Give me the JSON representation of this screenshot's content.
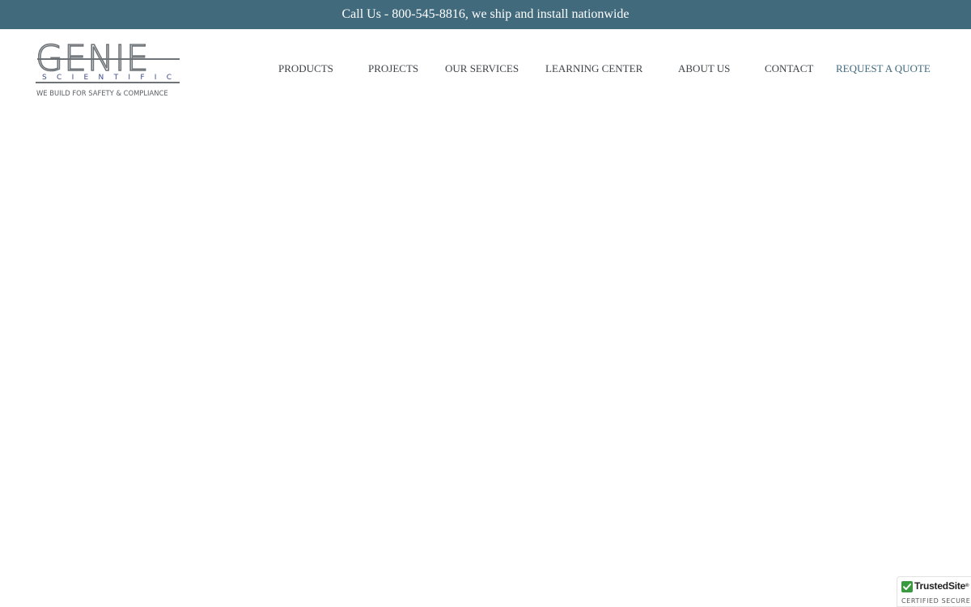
{
  "topbar": {
    "text": "Call Us - 800-545-8816, we ship and install nationwide"
  },
  "logo": {
    "wordmark": "GENIE",
    "subtitle": "SCIENTIFIC",
    "tagline": "WE BUILD FOR SAFETY & COMPLIANCE"
  },
  "nav": {
    "items": [
      {
        "label": "PRODUCTS"
      },
      {
        "label": "PROJECTS"
      },
      {
        "label": "OUR SERVICES"
      },
      {
        "label": "LEARNING CENTER"
      },
      {
        "label": "ABOUT US"
      },
      {
        "label": "CONTACT"
      },
      {
        "label": "REQUEST A QUOTE"
      }
    ]
  },
  "trusted_badge": {
    "brand_1": "Trusted",
    "brand_2": "Site",
    "trademark": "®",
    "subtitle": "CERTIFIED SECURE",
    "icon": "checkmark-icon"
  },
  "colors": {
    "topbar_bg": "#416a7d",
    "accent": "#416a7d",
    "nav_text": "#3f4448",
    "logo_gray": "#6e7377",
    "logo_blue": "#3d4a8a",
    "trusted_green": "#3a9a3f"
  }
}
